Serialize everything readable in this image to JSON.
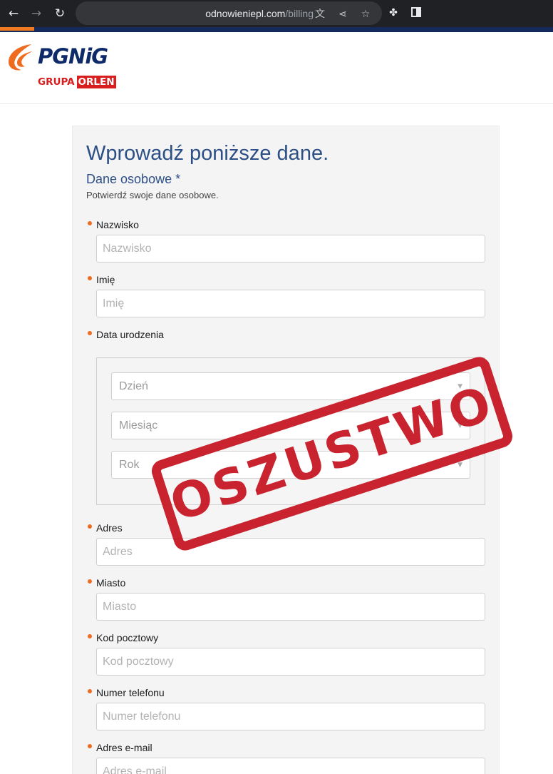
{
  "browser": {
    "url_domain": "odnowieniepl.com",
    "url_path": "/billing",
    "colors": {
      "toolbar": "#202124",
      "omnibox": "#35363a",
      "progress": "#ef7a1f"
    },
    "icons": [
      "back-arrow-icon",
      "forward-arrow-icon",
      "reload-icon",
      "translate-icon",
      "share-icon",
      "bookmark-star-icon",
      "extensions-icon",
      "side-panel-icon"
    ]
  },
  "brand": {
    "logo_name": "PGNiG",
    "logo_group": "GRUPA",
    "logo_group_box": "ORLEN",
    "colors": {
      "navy": "#0e2a68",
      "red": "#d81e1e",
      "flame": "#ef6b1e"
    }
  },
  "form": {
    "title": "Wprowadź poniższe dane.",
    "section_title": "Dane osobowe *",
    "section_hint": "Potwierdź swoje dane osobowe.",
    "required_dot_color": "#ef6b1e",
    "fields": [
      {
        "label": "Nazwisko",
        "placeholder": "Nazwisko",
        "value": ""
      },
      {
        "label": "Imię",
        "placeholder": "Imię",
        "value": ""
      },
      {
        "label": "Data urodzenia"
      },
      {
        "label": "Adres",
        "placeholder": "Adres",
        "value": ""
      },
      {
        "label": "Miasto",
        "placeholder": "Miasto",
        "value": ""
      },
      {
        "label": "Kod pocztowy",
        "placeholder": "Kod pocztowy",
        "value": ""
      },
      {
        "label": "Numer telefonu",
        "placeholder": "Numer telefonu",
        "value": ""
      },
      {
        "label": "Adres e-mail",
        "placeholder": "Adres e-mail",
        "value": ""
      }
    ],
    "dob": {
      "day": "Dzień",
      "month": "Miesiąc",
      "year": "Rok"
    }
  },
  "overlay": {
    "stamp_text": "OSZUSTWO",
    "color": "#c4121e"
  }
}
